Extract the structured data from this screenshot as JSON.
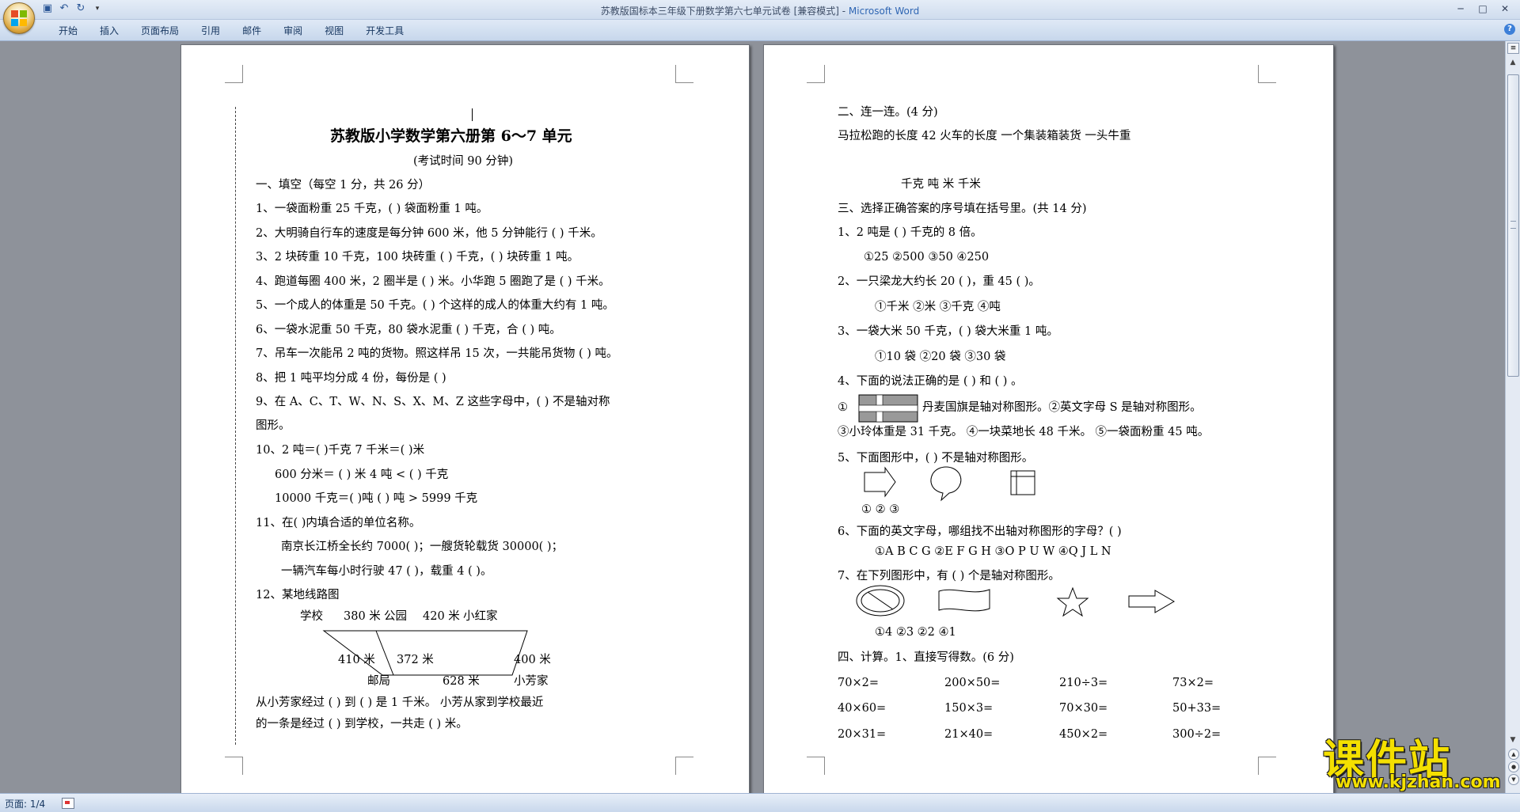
{
  "window": {
    "title": "苏教版国标本三年级下册数学第六七单元试卷 [兼容模式] - ",
    "app_name": "Microsoft Word",
    "controls": [
      "─",
      "□",
      "✕"
    ]
  },
  "qat": [
    "save-icon",
    "undo-icon",
    "redo-icon",
    "customize-icon"
  ],
  "ribbon": {
    "tabs": [
      "开始",
      "插入",
      "页面布局",
      "引用",
      "邮件",
      "审阅",
      "视图",
      "开发工具"
    ]
  },
  "status": {
    "page": "页面: 1/4"
  },
  "watermark": {
    "text": "课件站",
    "url": "www.kjzhan.com"
  },
  "page1": {
    "lines": [
      "苏教版小学数学第六册第 6～7 单元",
      "(考试时间 90 分钟)",
      "一、填空（每空 1 分，共 26 分）",
      "1、一袋面粉重 25 千克，(     ) 袋面粉重 1 吨。",
      "2、大明骑自行车的速度是每分钟 600 米，他 5 分钟能行 (       ) 千米。",
      "3、2 块砖重 10 千克，100 块砖重 (          ) 千克，(         ) 块砖重 1 吨。",
      "4、跑道每圈 400 米，2 圈半是 (       ) 米。小华跑 5 圈跑了是 (      ) 千米。",
      "5、一个成人的体重是 50 千克。(      ) 个这样的成人的体重大约有 1 吨。",
      "6、一袋水泥重 50 千克，80 袋水泥重 (           ) 千克，合 (           ) 吨。",
      "7、吊车一次能吊 2 吨的货物。照这样吊 15 次，一共能吊货物 (       ) 吨。",
      "8、把 1 吨平均分成 4 份，每份是 (          )",
      "9、在 A、C、T、W、N、S、X、M、Z 这些字母中，(                ) 不是轴对称",
      "图形。",
      "10、2 吨＝(           )千克          7 千米＝(              )米",
      "600 分米＝ (       ) 米          4 吨 < (         ) 千克",
      "10000 千克＝(          )吨       (          ) 吨 > 5999 千克",
      "11、在(          )内填合适的单位名称。",
      "南京长江桥全长约 7000(          )；一艘货轮载货 30000(       )；",
      "一辆汽车每小时行驶 47 (        )，载重 4 (       )。",
      "12、某地线路图",
      " 从小芳家经过 (         ) 到 (          ) 是 1 千米。 小芳从家到学校最近",
      "的一条是经过 (        ) 到学校，一共走 (          ) 米。"
    ],
    "map_labels": [
      "学校",
      "380 米",
      "公园",
      "420 米",
      "小红家",
      "410 米",
      "372 米",
      "400 米",
      "邮局",
      "628 米",
      "小芳家"
    ]
  },
  "page2": {
    "lines": [
      "二、连一连。(4 分)",
      "马拉松跑的长度 42      火车的长度        一个集装箱装货      一头牛重",
      "千克            吨                米                千米",
      "三、选择正确答案的序号填在括号里。(共 14 分)",
      "1、2 吨是 (        ) 千克的 8 倍。",
      "①25         ②500         ③50         ④250",
      "2、一只梁龙大约长 20 (          )，重 45 (        )。",
      "①千米          ②米       ③千克          ④吨",
      "3、一袋大米 50 千克，(          ) 袋大米重 1 吨。",
      "①10 袋      ②20 袋      ③30 袋",
      "4、下面的说法正确的是 (       ) 和 (       ) 。",
      "①",
      "丹麦国旗是轴对称图形。②英文字母 S 是轴对称图形。",
      "③小玲体重是 31 千克。     ④一块菜地长 48 千米。   ⑤一袋面粉重 45 吨。",
      "5、下面图形中，(           ) 不是轴对称图形。",
      "①                ②               ③",
      "6、下面的英文字母，哪组找不出轴对称图形的字母？(        )",
      "①A B C G    ②E F G H    ③O P U W    ④Q J L N",
      "7、在下列图形中，有 (           ) 个是轴对称图形。",
      "①4                 ②3                ②2             ④1",
      "四、计算。1、直接写得数。(6 分)"
    ],
    "calc": [
      [
        "70×2=",
        "200×50=",
        "210÷3=",
        "73×2="
      ],
      [
        "40×60=",
        "150×3=",
        "70×30=",
        "50+33="
      ],
      [
        "20×31=",
        "21×40=",
        "450×2=",
        "300÷2="
      ]
    ]
  }
}
